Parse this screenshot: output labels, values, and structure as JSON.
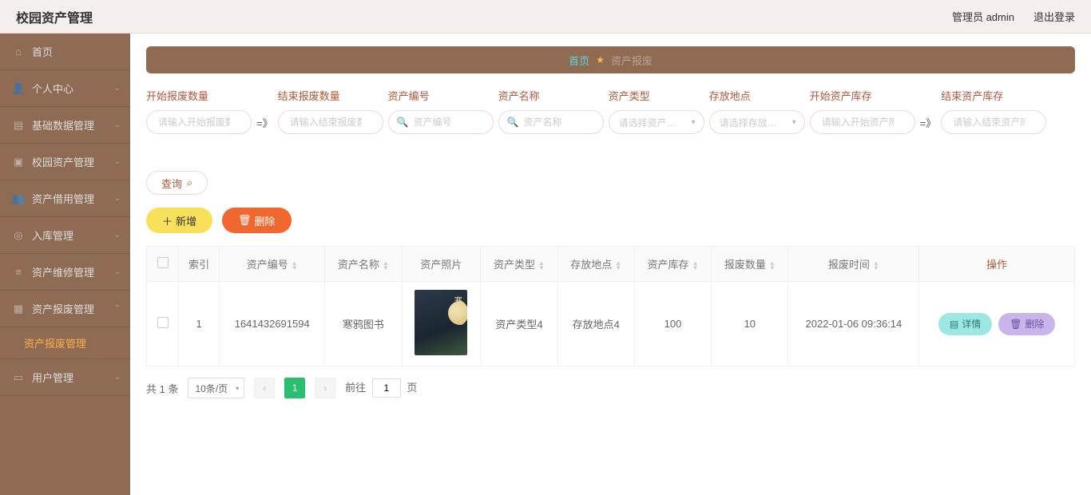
{
  "topbar": {
    "title": "校园资产管理",
    "admin": "管理员 admin",
    "logout": "退出登录"
  },
  "sidebar": {
    "items": [
      {
        "label": "首页",
        "icon": "home"
      },
      {
        "label": "个人中心",
        "icon": "user"
      },
      {
        "label": "基础数据管理",
        "icon": "db"
      },
      {
        "label": "校园资产管理",
        "icon": "asset"
      },
      {
        "label": "资产借用管理",
        "icon": "borrow"
      },
      {
        "label": "入库管理",
        "icon": "in"
      },
      {
        "label": "资产维修管理",
        "icon": "repair"
      },
      {
        "label": "资产报废管理",
        "icon": "scrap"
      },
      {
        "label": "用户管理",
        "icon": "users"
      }
    ],
    "subActive": "资产报废管理"
  },
  "breadcrumb": {
    "home": "首页",
    "current": "资产报废"
  },
  "filters": {
    "startQty": {
      "label": "开始报废数量",
      "placeholder": "请输入开始报废数"
    },
    "endQty": {
      "label": "结束报废数量",
      "placeholder": "请输入结束报废数"
    },
    "assetNo": {
      "label": "资产编号",
      "placeholder": "资产编号"
    },
    "assetName": {
      "label": "资产名称",
      "placeholder": "资产名称"
    },
    "assetType": {
      "label": "资产类型",
      "placeholder": "请选择资产类型"
    },
    "location": {
      "label": "存放地点",
      "placeholder": "请选择存放地点"
    },
    "startStock": {
      "label": "开始资产库存",
      "placeholder": "请输入开始资产库"
    },
    "endStock": {
      "label": "结束资产库存",
      "placeholder": "请输入结束资产库"
    },
    "arrow": "=》",
    "queryBtn": "查询"
  },
  "actions": {
    "add": "新增",
    "del": "删除"
  },
  "table": {
    "headers": {
      "index": "索引",
      "assetNo": "资产编号",
      "assetName": "资产名称",
      "photo": "资产照片",
      "assetType": "资产类型",
      "location": "存放地点",
      "stock": "资产库存",
      "scrapQty": "报废数量",
      "scrapTime": "报废时间",
      "op": "操作"
    },
    "rows": [
      {
        "index": "1",
        "assetNo": "1641432691594",
        "assetName": "寒鸦图书",
        "assetType": "资产类型4",
        "location": "存放地点4",
        "stock": "100",
        "scrapQty": "10",
        "scrapTime": "2022-01-06 09:36:14"
      }
    ],
    "rowBtns": {
      "detail": "详情",
      "del": "删除"
    }
  },
  "pager": {
    "total": "共 1 条",
    "pageSize": "10条/页",
    "currentPage": "1",
    "gotoLabel": "前往",
    "gotoSuffix": "页",
    "gotoValue": "1"
  },
  "chart_data": {
    "type": "table",
    "title": "资产报废",
    "columns": [
      "索引",
      "资产编号",
      "资产名称",
      "资产类型",
      "存放地点",
      "资产库存",
      "报废数量",
      "报废时间"
    ],
    "rows": [
      [
        "1",
        "1641432691594",
        "寒鸦图书",
        "资产类型4",
        "存放地点4",
        100,
        10,
        "2022-01-06 09:36:14"
      ]
    ]
  }
}
